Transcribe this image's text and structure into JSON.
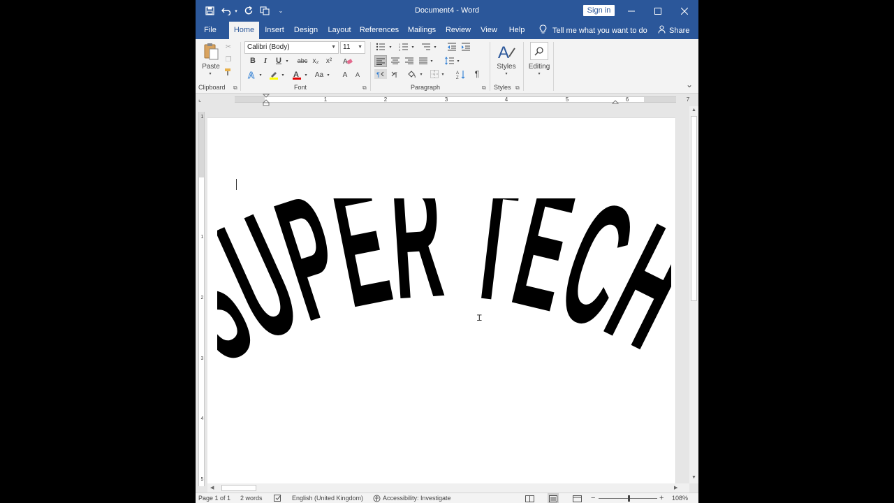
{
  "titlebar": {
    "doc_title": "Document4  -  Word",
    "signin_label": "Sign in"
  },
  "tabs": [
    {
      "label": "File"
    },
    {
      "label": "Home",
      "active": true
    },
    {
      "label": "Insert"
    },
    {
      "label": "Design"
    },
    {
      "label": "Layout"
    },
    {
      "label": "References"
    },
    {
      "label": "Mailings"
    },
    {
      "label": "Review"
    },
    {
      "label": "View"
    },
    {
      "label": "Help"
    }
  ],
  "tellme": "Tell me what you want to do",
  "share": "Share",
  "ribbon": {
    "clipboard": {
      "paste": "Paste",
      "label": "Clipboard"
    },
    "font": {
      "name": "Calibri (Body)",
      "size": "11",
      "label": "Font",
      "bold": "B",
      "italic": "I",
      "underline": "U",
      "strike": "abc",
      "subscript": "x₂",
      "superscript": "x²",
      "grow": "A",
      "shrink": "A",
      "change_case": "Aa"
    },
    "paragraph": {
      "label": "Paragraph",
      "pilcrow": "¶"
    },
    "styles": {
      "label": "Styles",
      "button": "Styles"
    },
    "editing": {
      "button": "Editing"
    }
  },
  "ruler_numbers": [
    "1",
    "2",
    "3",
    "4",
    "5",
    "6",
    "7"
  ],
  "vruler_numbers": [
    "1",
    "1",
    "2",
    "3",
    "4",
    "5"
  ],
  "document": {
    "wordart_text": "SUPER TECH"
  },
  "statusbar": {
    "page": "Page 1 of 1",
    "words": "2 words",
    "language": "English (United Kingdom)",
    "accessibility": "Accessibility: Investigate",
    "zoom": "108%"
  }
}
